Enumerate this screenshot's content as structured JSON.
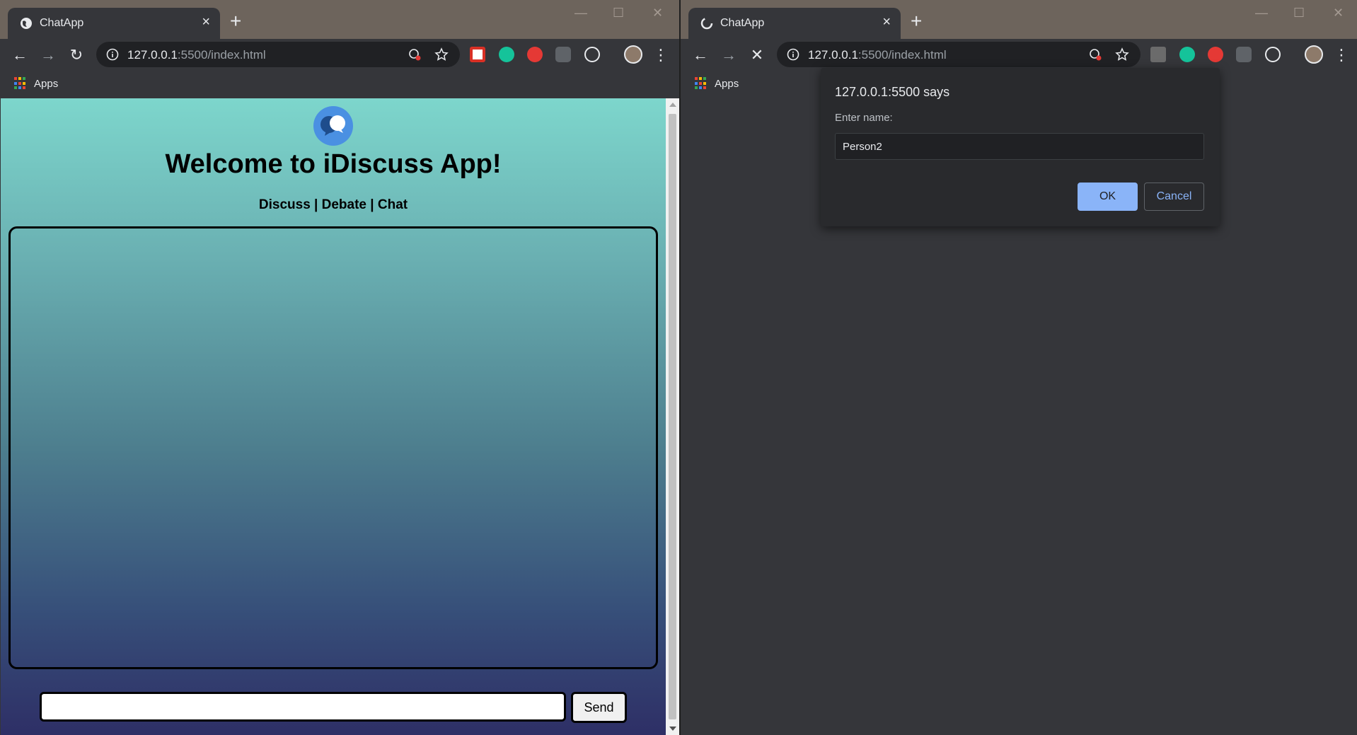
{
  "left_window": {
    "tab_title": "ChatApp",
    "url_host": "127.0.0.1",
    "url_rest": ":5500/index.html",
    "bookmarks_label": "Apps",
    "page": {
      "heading": "Welcome to iDiscuss App!",
      "subnav": "Discuss | Debate | Chat",
      "message_input_value": "",
      "send_label": "Send"
    }
  },
  "right_window": {
    "tab_title": "ChatApp",
    "url_host": "127.0.0.1",
    "url_rest": ":5500/index.html",
    "bookmarks_label": "Apps",
    "dialog": {
      "title": "127.0.0.1:5500 says",
      "message": "Enter name:",
      "input_value": "Person2",
      "ok_label": "OK",
      "cancel_label": "Cancel"
    }
  },
  "colors": {
    "browser_frame": "#6d645c",
    "toolbar": "#35363a",
    "dialog_bg": "#292a2d",
    "accent_blue": "#8ab4f8",
    "page_gradient_top": "#7dd6cc",
    "page_gradient_bottom": "#2e2f66"
  }
}
